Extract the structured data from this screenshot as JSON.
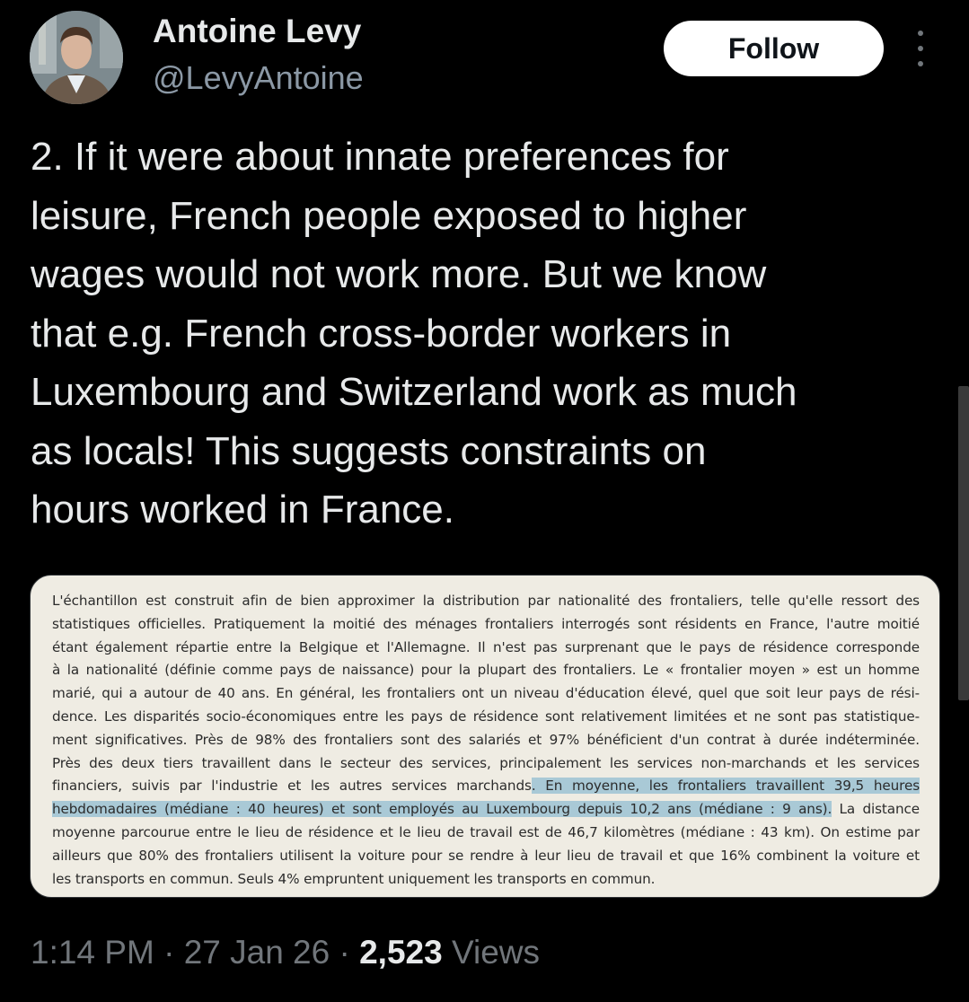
{
  "author": {
    "name": "Antoine Levy",
    "handle": "@LevyAntoine",
    "follow_label": "Follow"
  },
  "tweet": {
    "text": "2. If it were about innate preferences for\nleisure, French people exposed to higher\nwages would not work more. But we know\nthat e.g. French cross-border workers in\nLuxembourg and Switzerland work as much\nas locals! This suggests constraints on\nhours worked in France."
  },
  "media": {
    "lines": [
      "L'échantillon est construit afin de bien approximer la distribution par nationalité des frontaliers, telle qu'elle ressort des",
      "statistiques officielles. Pratiquement la moitié des ménages frontaliers interrogés sont résidents en France, l'autre moitié",
      "étant également répartie entre la Belgique et l'Allemagne. Il n'est pas surprenant que le pays de résidence corresponde",
      "à la nationalité (définie comme pays de naissance) pour la plupart des frontaliers. Le « frontalier moyen » est un homme",
      "marié, qui a autour de 40 ans. En général, les frontaliers ont un niveau d'éducation élevé, quel que soit leur pays de rési-",
      "dence. Les disparités socio-économiques entre les pays de résidence sont relativement limitées et ne sont pas statistique-",
      "ment significatives. Près de 98% des frontaliers sont des salariés et 97% bénéficient d'un contrat à durée indéterminée.",
      "Près des deux tiers travaillent dans le secteur des services, principalement les services non-marchands et les services"
    ],
    "line9_pre": "financiers, suivis par l'industrie et les autres services marchands",
    "line9_hl": ". En moyenne, les frontaliers travaillent 39,5 heures",
    "line10_hl": "hebdomadaires (médiane : 40 heures) et sont employés au Luxembourg depuis 10,2 ans (médiane : 9 ans).",
    "line10_post": " La distance",
    "lines_after": [
      "moyenne parcourue entre le lieu de résidence et le lieu de travail est de 46,7 kilomètres (médiane : 43 km). On estime par",
      "ailleurs que 80% des frontaliers utilisent la voiture pour se rendre à leur lieu de travail et que 16% combinent la voiture et"
    ],
    "last_line": "les transports en commun. Seuls 4% empruntent uniquement les transports en commun."
  },
  "meta": {
    "time": "1:14 PM",
    "sep1": " · ",
    "date": "27 Jan 26",
    "sep2": " · ",
    "views_count": "2,523",
    "views_label": " Views"
  },
  "icons": {
    "more": "more-vertical-icon",
    "avatar": "profile-photo"
  }
}
